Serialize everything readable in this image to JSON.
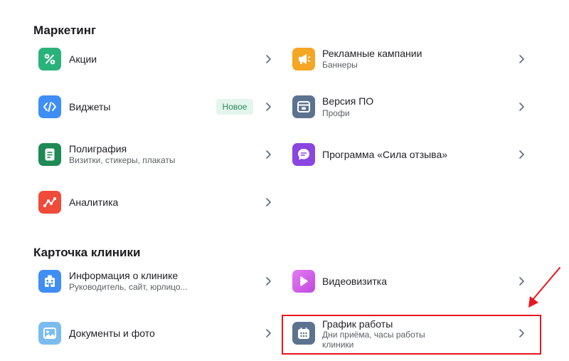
{
  "sections": {
    "marketing": {
      "title": "Маркетинг"
    },
    "clinic_card": {
      "title": "Карточка клиники"
    }
  },
  "items": {
    "promotions": {
      "label": "Акции",
      "icon": "percent-icon",
      "color": "#2ab27b"
    },
    "ad_campaigns": {
      "label": "Рекламные кампании",
      "sublabel": "Баннеры",
      "icon": "megaphone-icon",
      "color": "#f5a623"
    },
    "widgets": {
      "label": "Виджеты",
      "badge": "Новое",
      "icon": "code-icon",
      "color": "#3f8ef5"
    },
    "software_version": {
      "label": "Версия ПО",
      "sublabel": "Профи",
      "icon": "window-icon",
      "color": "#5c7390"
    },
    "printing": {
      "label": "Полиграфия",
      "sublabel": "Визитки, стикеры, плакаты",
      "icon": "document-icon",
      "color": "#1e8a55"
    },
    "feedback_program": {
      "label": "Программа «Сила отзыва»",
      "icon": "chat-icon",
      "color": "#8b45e0"
    },
    "analytics": {
      "label": "Аналитика",
      "icon": "graph-icon",
      "color": "#f04a3a"
    },
    "clinic_info": {
      "label": "Информация о клинике",
      "sublabel": "Руководитель, сайт, юрлицо...",
      "icon": "building-icon",
      "color": "#3f8ef5"
    },
    "video_card": {
      "label": "Видеовизитка",
      "icon": "play-icon",
      "color": "#cf5ce8"
    },
    "documents_photo": {
      "label": "Документы и фото",
      "icon": "image-icon",
      "color": "#7bbcf0"
    },
    "work_schedule": {
      "label": "График работы",
      "sublabel_line1": "Дни приёма, часы работы",
      "sublabel_line2": "клиники",
      "icon": "calendar-icon",
      "color": "#5c7390"
    }
  },
  "annotation": {
    "highlight_color": "#e8161e"
  }
}
